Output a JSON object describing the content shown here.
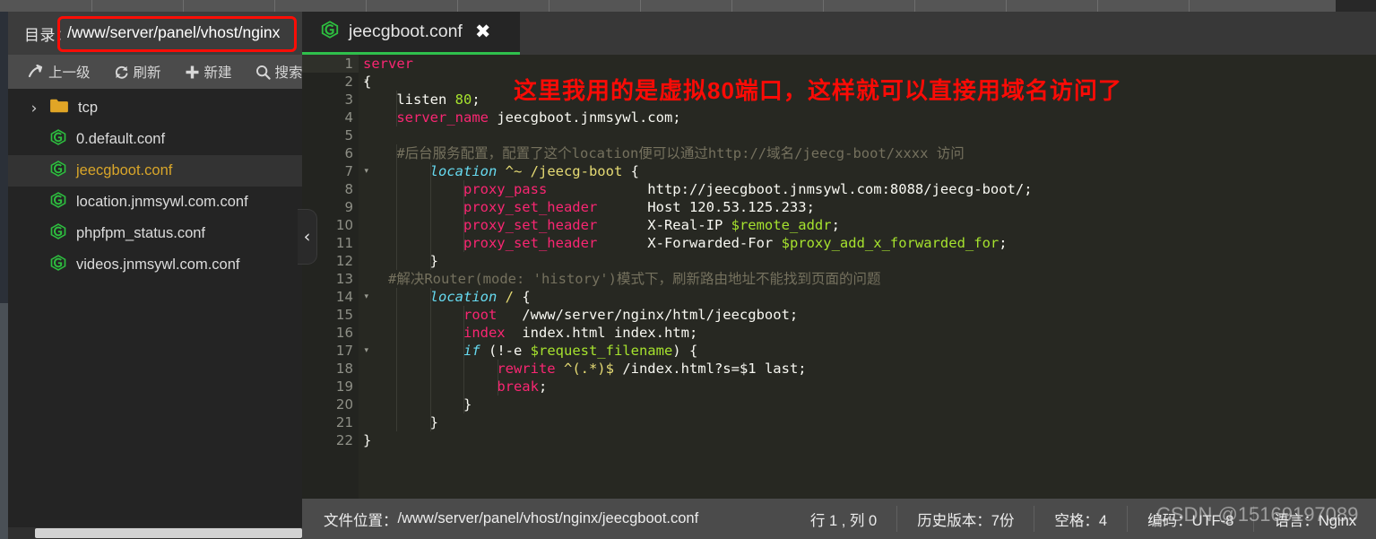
{
  "window": {
    "top_strip_divider_count": 13
  },
  "file_browser": {
    "dir_label": "目录：",
    "dir_path": "/www/server/panel/vhost/nginx",
    "toolbar": [
      {
        "icon": "arrow-up-level-icon",
        "label": "上一级"
      },
      {
        "icon": "refresh-icon",
        "label": "刷新"
      },
      {
        "icon": "plus-icon",
        "label": "新建"
      },
      {
        "icon": "search-icon",
        "label": "搜索"
      }
    ],
    "items": [
      {
        "type": "folder",
        "icon": "folder-icon",
        "chevron": "›",
        "label": "tcp",
        "selected": false
      },
      {
        "type": "file",
        "icon": "nginx-conf-icon",
        "label": "0.default.conf",
        "selected": false
      },
      {
        "type": "file",
        "icon": "nginx-conf-icon",
        "label": "jeecgboot.conf",
        "selected": true
      },
      {
        "type": "file",
        "icon": "nginx-conf-icon",
        "label": "location.jnmsywl.com.conf",
        "selected": false
      },
      {
        "type": "file",
        "icon": "nginx-conf-icon",
        "label": "phpfpm_status.conf",
        "selected": false
      },
      {
        "type": "file",
        "icon": "nginx-conf-icon",
        "label": "videos.jnmsywl.com.conf",
        "selected": false
      }
    ],
    "collapse_handle": "‹"
  },
  "editor": {
    "tab": {
      "icon": "nginx-conf-icon",
      "title": "jeecgboot.conf",
      "close": "✖"
    },
    "annotation": "这里我用的是虚拟80端口，这样就可以直接用域名访问了",
    "lines": [
      {
        "n": "1",
        "fold": "",
        "current": true,
        "tokens": [
          {
            "t": "server",
            "c": "k-red"
          }
        ]
      },
      {
        "n": "2",
        "fold": "▾",
        "current": false,
        "tokens": [
          {
            "t": "{",
            "c": "k-white"
          }
        ]
      },
      {
        "n": "3",
        "fold": "",
        "current": false,
        "tokens": [
          {
            "t": "    listen ",
            "c": "k-white"
          },
          {
            "t": "80",
            "c": "k-green"
          },
          {
            "t": ";",
            "c": "k-white"
          }
        ]
      },
      {
        "n": "4",
        "fold": "",
        "current": false,
        "tokens": [
          {
            "t": "    ",
            "c": "k-white"
          },
          {
            "t": "server_name",
            "c": "k-red"
          },
          {
            "t": " jeecgboot.jnmsywl.com;",
            "c": "k-white"
          }
        ]
      },
      {
        "n": "5",
        "fold": "",
        "current": false,
        "tokens": []
      },
      {
        "n": "6",
        "fold": "",
        "current": false,
        "tokens": [
          {
            "t": "    #后台服务配置，配置了这个location便可以通过http://域名/jeecg-boot/xxxx 访问",
            "c": "k-comment"
          }
        ]
      },
      {
        "n": "7",
        "fold": "▾",
        "current": false,
        "tokens": [
          {
            "t": "        ",
            "c": "k-white"
          },
          {
            "t": "location",
            "c": "k-blueit"
          },
          {
            "t": " ",
            "c": "k-white"
          },
          {
            "t": "^~ /jeecg-boot",
            "c": "k-yellow"
          },
          {
            "t": " {",
            "c": "k-white"
          }
        ]
      },
      {
        "n": "8",
        "fold": "",
        "current": false,
        "tokens": [
          {
            "t": "            ",
            "c": "k-white"
          },
          {
            "t": "proxy_pass",
            "c": "k-red"
          },
          {
            "t": "            http://jeecgboot.jnmsywl.com:8088/jeecg-boot/;",
            "c": "k-white"
          }
        ]
      },
      {
        "n": "9",
        "fold": "",
        "current": false,
        "tokens": [
          {
            "t": "            ",
            "c": "k-white"
          },
          {
            "t": "proxy_set_header",
            "c": "k-red"
          },
          {
            "t": "      Host 120.53.125.233;",
            "c": "k-white"
          }
        ]
      },
      {
        "n": "10",
        "fold": "",
        "current": false,
        "tokens": [
          {
            "t": "            ",
            "c": "k-white"
          },
          {
            "t": "proxy_set_header",
            "c": "k-red"
          },
          {
            "t": "      X-Real-IP ",
            "c": "k-white"
          },
          {
            "t": "$remote_addr",
            "c": "k-green"
          },
          {
            "t": ";",
            "c": "k-white"
          }
        ]
      },
      {
        "n": "11",
        "fold": "",
        "current": false,
        "tokens": [
          {
            "t": "            ",
            "c": "k-white"
          },
          {
            "t": "proxy_set_header",
            "c": "k-red"
          },
          {
            "t": "      X-Forwarded-For ",
            "c": "k-white"
          },
          {
            "t": "$proxy_add_x_forwarded_for",
            "c": "k-green"
          },
          {
            "t": ";",
            "c": "k-white"
          }
        ]
      },
      {
        "n": "12",
        "fold": "",
        "current": false,
        "tokens": [
          {
            "t": "        }",
            "c": "k-white"
          }
        ]
      },
      {
        "n": "13",
        "fold": "",
        "current": false,
        "tokens": [
          {
            "t": "   #解决Router(mode: 'history')模式下，刷新路由地址不能找到页面的问题",
            "c": "k-comment"
          }
        ]
      },
      {
        "n": "14",
        "fold": "▾",
        "current": false,
        "tokens": [
          {
            "t": "        ",
            "c": "k-white"
          },
          {
            "t": "location",
            "c": "k-blueit"
          },
          {
            "t": " ",
            "c": "k-white"
          },
          {
            "t": "/",
            "c": "k-yellow"
          },
          {
            "t": " {",
            "c": "k-white"
          }
        ]
      },
      {
        "n": "15",
        "fold": "",
        "current": false,
        "tokens": [
          {
            "t": "            ",
            "c": "k-white"
          },
          {
            "t": "root",
            "c": "k-red"
          },
          {
            "t": "   /www/server/nginx/html/jeecgboot;",
            "c": "k-white"
          }
        ]
      },
      {
        "n": "16",
        "fold": "",
        "current": false,
        "tokens": [
          {
            "t": "            ",
            "c": "k-white"
          },
          {
            "t": "index",
            "c": "k-red"
          },
          {
            "t": "  index.html index.htm;",
            "c": "k-white"
          }
        ]
      },
      {
        "n": "17",
        "fold": "▾",
        "current": false,
        "tokens": [
          {
            "t": "            ",
            "c": "k-white"
          },
          {
            "t": "if",
            "c": "k-blueit"
          },
          {
            "t": " (!-e ",
            "c": "k-white"
          },
          {
            "t": "$request_filename",
            "c": "k-green"
          },
          {
            "t": ") {",
            "c": "k-white"
          }
        ]
      },
      {
        "n": "18",
        "fold": "",
        "current": false,
        "tokens": [
          {
            "t": "                ",
            "c": "k-white"
          },
          {
            "t": "rewrite",
            "c": "k-red"
          },
          {
            "t": " ",
            "c": "k-white"
          },
          {
            "t": "^(.*)$",
            "c": "k-yellow"
          },
          {
            "t": " /index.html?s=$1 last;",
            "c": "k-white"
          }
        ]
      },
      {
        "n": "19",
        "fold": "",
        "current": false,
        "tokens": [
          {
            "t": "                ",
            "c": "k-white"
          },
          {
            "t": "break",
            "c": "k-red"
          },
          {
            "t": ";",
            "c": "k-white"
          }
        ]
      },
      {
        "n": "20",
        "fold": "",
        "current": false,
        "tokens": [
          {
            "t": "            }",
            "c": "k-white"
          }
        ]
      },
      {
        "n": "21",
        "fold": "",
        "current": false,
        "tokens": [
          {
            "t": "        }",
            "c": "k-white"
          }
        ]
      },
      {
        "n": "22",
        "fold": "",
        "current": false,
        "tokens": [
          {
            "t": "}",
            "c": "k-white"
          }
        ]
      }
    ]
  },
  "status_bar": {
    "file_path_label": "文件位置：",
    "file_path": "/www/server/panel/vhost/nginx/jeecgboot.conf",
    "cursor": "行 1 , 列 0",
    "history": "历史版本：7份",
    "indent": "空格：4",
    "encoding": "编码：UTF-8",
    "language": "语言：Nginx"
  },
  "watermark": "CSDN @15169197089",
  "colors": {
    "accent_green": "#2fc04c",
    "annotation_red": "#fb0b06",
    "selected_file": "#d9a62a",
    "editor_bg": "#272822"
  }
}
